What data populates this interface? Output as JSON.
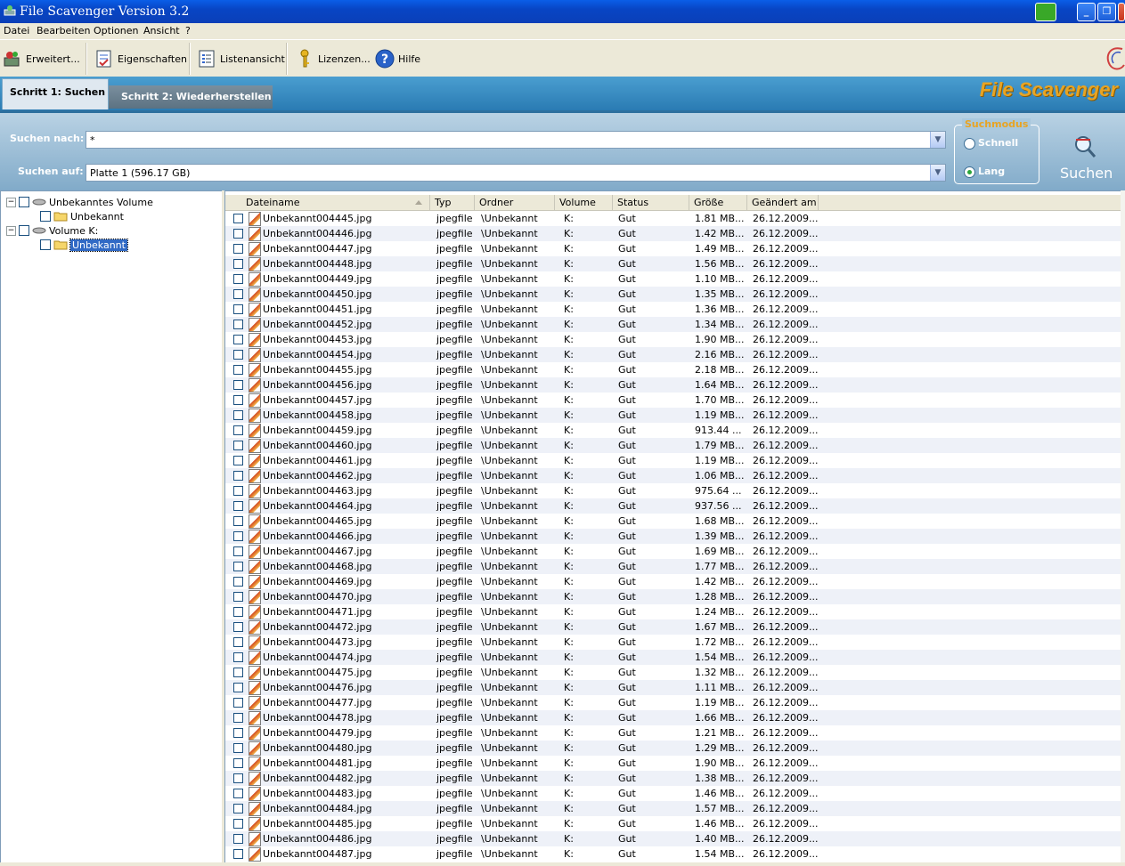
{
  "window": {
    "title": "File Scavenger Version 3.2"
  },
  "menu": {
    "items": [
      {
        "label": "Datei"
      },
      {
        "label": "Bearbeiten"
      },
      {
        "label": "Optionen"
      },
      {
        "label": "Ansicht"
      },
      {
        "label": "?"
      }
    ]
  },
  "toolbar": {
    "advanced": "Erweitert...",
    "properties": "Eigenschaften",
    "listview": "Listenansicht",
    "licenses": "Lizenzen...",
    "help": "Hilfe"
  },
  "tabs": {
    "step1": "Schritt 1: Suchen",
    "step2": "Schritt 2: Wiederherstellen",
    "brand": "File Scavenger"
  },
  "search": {
    "search_for_label": "Suchen nach:",
    "search_for_value": "*",
    "search_in_label": "Suchen auf:",
    "search_in_value": "Platte 1 (596.17 GB)",
    "mode_title": "Suchmodus",
    "mode_fast": "Schnell",
    "mode_long": "Lang",
    "mode_selected": "Lang",
    "button": "Suchen"
  },
  "tree": {
    "nodes": [
      {
        "label": "Unbekanntes Volume"
      },
      {
        "label": "Unbekannt"
      },
      {
        "label": "Volume K:"
      },
      {
        "label": "Unbekannt"
      }
    ]
  },
  "list": {
    "columns": [
      "Dateiname",
      "Typ",
      "Ordner",
      "Volume",
      "Status",
      "Größe",
      "Geändert am"
    ],
    "rows": [
      {
        "name": "Unbekannt004445.jpg",
        "type": "jpegfile",
        "folder": "\\Unbekannt",
        "volume": "K:",
        "status": "Gut",
        "size": "1.81 MB...",
        "modified": "26.12.2009..."
      },
      {
        "name": "Unbekannt004446.jpg",
        "type": "jpegfile",
        "folder": "\\Unbekannt",
        "volume": "K:",
        "status": "Gut",
        "size": "1.42 MB...",
        "modified": "26.12.2009..."
      },
      {
        "name": "Unbekannt004447.jpg",
        "type": "jpegfile",
        "folder": "\\Unbekannt",
        "volume": "K:",
        "status": "Gut",
        "size": "1.49 MB...",
        "modified": "26.12.2009..."
      },
      {
        "name": "Unbekannt004448.jpg",
        "type": "jpegfile",
        "folder": "\\Unbekannt",
        "volume": "K:",
        "status": "Gut",
        "size": "1.56 MB...",
        "modified": "26.12.2009..."
      },
      {
        "name": "Unbekannt004449.jpg",
        "type": "jpegfile",
        "folder": "\\Unbekannt",
        "volume": "K:",
        "status": "Gut",
        "size": "1.10 MB...",
        "modified": "26.12.2009..."
      },
      {
        "name": "Unbekannt004450.jpg",
        "type": "jpegfile",
        "folder": "\\Unbekannt",
        "volume": "K:",
        "status": "Gut",
        "size": "1.35 MB...",
        "modified": "26.12.2009..."
      },
      {
        "name": "Unbekannt004451.jpg",
        "type": "jpegfile",
        "folder": "\\Unbekannt",
        "volume": "K:",
        "status": "Gut",
        "size": "1.36 MB...",
        "modified": "26.12.2009..."
      },
      {
        "name": "Unbekannt004452.jpg",
        "type": "jpegfile",
        "folder": "\\Unbekannt",
        "volume": "K:",
        "status": "Gut",
        "size": "1.34 MB...",
        "modified": "26.12.2009..."
      },
      {
        "name": "Unbekannt004453.jpg",
        "type": "jpegfile",
        "folder": "\\Unbekannt",
        "volume": "K:",
        "status": "Gut",
        "size": "1.90 MB...",
        "modified": "26.12.2009..."
      },
      {
        "name": "Unbekannt004454.jpg",
        "type": "jpegfile",
        "folder": "\\Unbekannt",
        "volume": "K:",
        "status": "Gut",
        "size": "2.16 MB...",
        "modified": "26.12.2009..."
      },
      {
        "name": "Unbekannt004455.jpg",
        "type": "jpegfile",
        "folder": "\\Unbekannt",
        "volume": "K:",
        "status": "Gut",
        "size": "2.18 MB...",
        "modified": "26.12.2009..."
      },
      {
        "name": "Unbekannt004456.jpg",
        "type": "jpegfile",
        "folder": "\\Unbekannt",
        "volume": "K:",
        "status": "Gut",
        "size": "1.64 MB...",
        "modified": "26.12.2009..."
      },
      {
        "name": "Unbekannt004457.jpg",
        "type": "jpegfile",
        "folder": "\\Unbekannt",
        "volume": "K:",
        "status": "Gut",
        "size": "1.70 MB...",
        "modified": "26.12.2009..."
      },
      {
        "name": "Unbekannt004458.jpg",
        "type": "jpegfile",
        "folder": "\\Unbekannt",
        "volume": "K:",
        "status": "Gut",
        "size": "1.19 MB...",
        "modified": "26.12.2009..."
      },
      {
        "name": "Unbekannt004459.jpg",
        "type": "jpegfile",
        "folder": "\\Unbekannt",
        "volume": "K:",
        "status": "Gut",
        "size": "913.44 ...",
        "modified": "26.12.2009..."
      },
      {
        "name": "Unbekannt004460.jpg",
        "type": "jpegfile",
        "folder": "\\Unbekannt",
        "volume": "K:",
        "status": "Gut",
        "size": "1.79 MB...",
        "modified": "26.12.2009..."
      },
      {
        "name": "Unbekannt004461.jpg",
        "type": "jpegfile",
        "folder": "\\Unbekannt",
        "volume": "K:",
        "status": "Gut",
        "size": "1.19 MB...",
        "modified": "26.12.2009..."
      },
      {
        "name": "Unbekannt004462.jpg",
        "type": "jpegfile",
        "folder": "\\Unbekannt",
        "volume": "K:",
        "status": "Gut",
        "size": "1.06 MB...",
        "modified": "26.12.2009..."
      },
      {
        "name": "Unbekannt004463.jpg",
        "type": "jpegfile",
        "folder": "\\Unbekannt",
        "volume": "K:",
        "status": "Gut",
        "size": "975.64 ...",
        "modified": "26.12.2009..."
      },
      {
        "name": "Unbekannt004464.jpg",
        "type": "jpegfile",
        "folder": "\\Unbekannt",
        "volume": "K:",
        "status": "Gut",
        "size": "937.56 ...",
        "modified": "26.12.2009..."
      },
      {
        "name": "Unbekannt004465.jpg",
        "type": "jpegfile",
        "folder": "\\Unbekannt",
        "volume": "K:",
        "status": "Gut",
        "size": "1.68 MB...",
        "modified": "26.12.2009..."
      },
      {
        "name": "Unbekannt004466.jpg",
        "type": "jpegfile",
        "folder": "\\Unbekannt",
        "volume": "K:",
        "status": "Gut",
        "size": "1.39 MB...",
        "modified": "26.12.2009..."
      },
      {
        "name": "Unbekannt004467.jpg",
        "type": "jpegfile",
        "folder": "\\Unbekannt",
        "volume": "K:",
        "status": "Gut",
        "size": "1.69 MB...",
        "modified": "26.12.2009..."
      },
      {
        "name": "Unbekannt004468.jpg",
        "type": "jpegfile",
        "folder": "\\Unbekannt",
        "volume": "K:",
        "status": "Gut",
        "size": "1.77 MB...",
        "modified": "26.12.2009..."
      },
      {
        "name": "Unbekannt004469.jpg",
        "type": "jpegfile",
        "folder": "\\Unbekannt",
        "volume": "K:",
        "status": "Gut",
        "size": "1.42 MB...",
        "modified": "26.12.2009..."
      },
      {
        "name": "Unbekannt004470.jpg",
        "type": "jpegfile",
        "folder": "\\Unbekannt",
        "volume": "K:",
        "status": "Gut",
        "size": "1.28 MB...",
        "modified": "26.12.2009..."
      },
      {
        "name": "Unbekannt004471.jpg",
        "type": "jpegfile",
        "folder": "\\Unbekannt",
        "volume": "K:",
        "status": "Gut",
        "size": "1.24 MB...",
        "modified": "26.12.2009..."
      },
      {
        "name": "Unbekannt004472.jpg",
        "type": "jpegfile",
        "folder": "\\Unbekannt",
        "volume": "K:",
        "status": "Gut",
        "size": "1.67 MB...",
        "modified": "26.12.2009..."
      },
      {
        "name": "Unbekannt004473.jpg",
        "type": "jpegfile",
        "folder": "\\Unbekannt",
        "volume": "K:",
        "status": "Gut",
        "size": "1.72 MB...",
        "modified": "26.12.2009..."
      },
      {
        "name": "Unbekannt004474.jpg",
        "type": "jpegfile",
        "folder": "\\Unbekannt",
        "volume": "K:",
        "status": "Gut",
        "size": "1.54 MB...",
        "modified": "26.12.2009..."
      },
      {
        "name": "Unbekannt004475.jpg",
        "type": "jpegfile",
        "folder": "\\Unbekannt",
        "volume": "K:",
        "status": "Gut",
        "size": "1.32 MB...",
        "modified": "26.12.2009..."
      },
      {
        "name": "Unbekannt004476.jpg",
        "type": "jpegfile",
        "folder": "\\Unbekannt",
        "volume": "K:",
        "status": "Gut",
        "size": "1.11 MB...",
        "modified": "26.12.2009..."
      },
      {
        "name": "Unbekannt004477.jpg",
        "type": "jpegfile",
        "folder": "\\Unbekannt",
        "volume": "K:",
        "status": "Gut",
        "size": "1.19 MB...",
        "modified": "26.12.2009..."
      },
      {
        "name": "Unbekannt004478.jpg",
        "type": "jpegfile",
        "folder": "\\Unbekannt",
        "volume": "K:",
        "status": "Gut",
        "size": "1.66 MB...",
        "modified": "26.12.2009..."
      },
      {
        "name": "Unbekannt004479.jpg",
        "type": "jpegfile",
        "folder": "\\Unbekannt",
        "volume": "K:",
        "status": "Gut",
        "size": "1.21 MB...",
        "modified": "26.12.2009..."
      },
      {
        "name": "Unbekannt004480.jpg",
        "type": "jpegfile",
        "folder": "\\Unbekannt",
        "volume": "K:",
        "status": "Gut",
        "size": "1.29 MB...",
        "modified": "26.12.2009..."
      },
      {
        "name": "Unbekannt004481.jpg",
        "type": "jpegfile",
        "folder": "\\Unbekannt",
        "volume": "K:",
        "status": "Gut",
        "size": "1.90 MB...",
        "modified": "26.12.2009..."
      },
      {
        "name": "Unbekannt004482.jpg",
        "type": "jpegfile",
        "folder": "\\Unbekannt",
        "volume": "K:",
        "status": "Gut",
        "size": "1.38 MB...",
        "modified": "26.12.2009..."
      },
      {
        "name": "Unbekannt004483.jpg",
        "type": "jpegfile",
        "folder": "\\Unbekannt",
        "volume": "K:",
        "status": "Gut",
        "size": "1.46 MB...",
        "modified": "26.12.2009..."
      },
      {
        "name": "Unbekannt004484.jpg",
        "type": "jpegfile",
        "folder": "\\Unbekannt",
        "volume": "K:",
        "status": "Gut",
        "size": "1.57 MB...",
        "modified": "26.12.2009..."
      },
      {
        "name": "Unbekannt004485.jpg",
        "type": "jpegfile",
        "folder": "\\Unbekannt",
        "volume": "K:",
        "status": "Gut",
        "size": "1.46 MB...",
        "modified": "26.12.2009..."
      },
      {
        "name": "Unbekannt004486.jpg",
        "type": "jpegfile",
        "folder": "\\Unbekannt",
        "volume": "K:",
        "status": "Gut",
        "size": "1.40 MB...",
        "modified": "26.12.2009..."
      },
      {
        "name": "Unbekannt004487.jpg",
        "type": "jpegfile",
        "folder": "\\Unbekannt",
        "volume": "K:",
        "status": "Gut",
        "size": "1.54 MB...",
        "modified": "26.12.2009..."
      }
    ]
  },
  "colors": {
    "titlebar": "#0845c4",
    "brand": "#e8a423",
    "selection": "#316ac5"
  }
}
